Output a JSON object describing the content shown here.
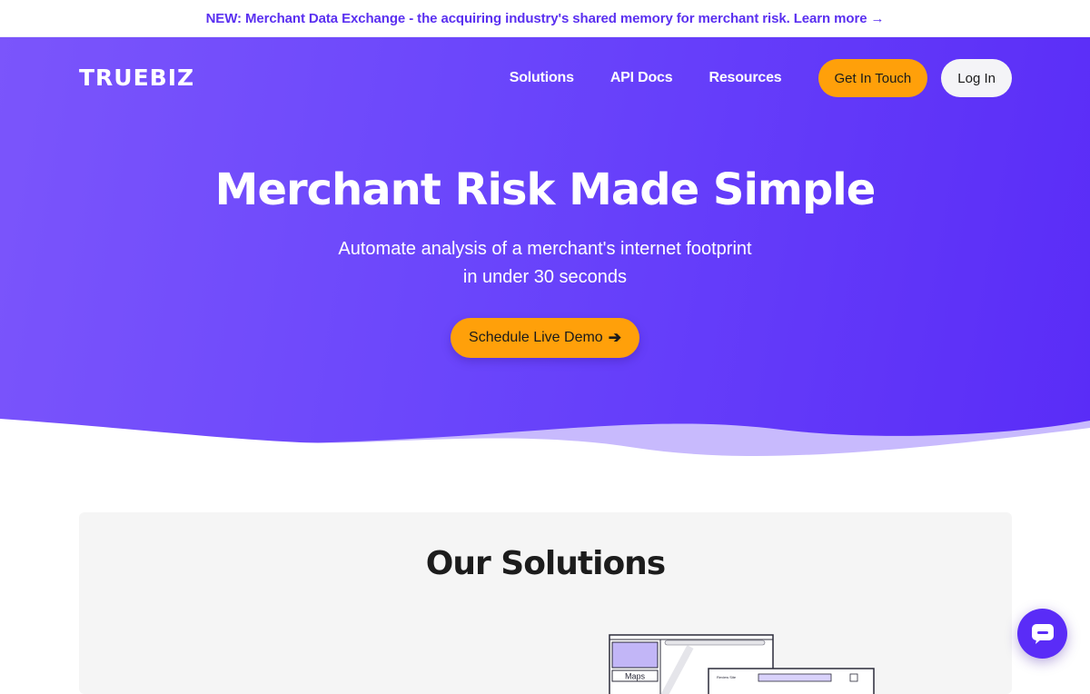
{
  "announcement": {
    "text": "NEW: Merchant Data Exchange - the acquiring industry's shared memory for merchant risk. Learn more →"
  },
  "header": {
    "logo": "TRUEBIZ",
    "nav": [
      "Solutions",
      "API Docs",
      "Resources"
    ],
    "get_in_touch": "Get In Touch",
    "login": "Log In"
  },
  "hero": {
    "title": "Merchant Risk Made Simple",
    "subtitle_line1": "Automate analysis of a merchant's internet footprint",
    "subtitle_line2": "in under 30 seconds",
    "cta": "Schedule Live Demo"
  },
  "solutions": {
    "title": "Our Solutions",
    "illustration_label": "Maps"
  },
  "icons": {
    "cta_arrow": "arrow-right-icon",
    "chat": "chat-bubble-icon"
  },
  "colors": {
    "brand_purple": "#6a45fb",
    "accent_orange": "#ffa00a",
    "link_purple": "#5a30f0"
  }
}
